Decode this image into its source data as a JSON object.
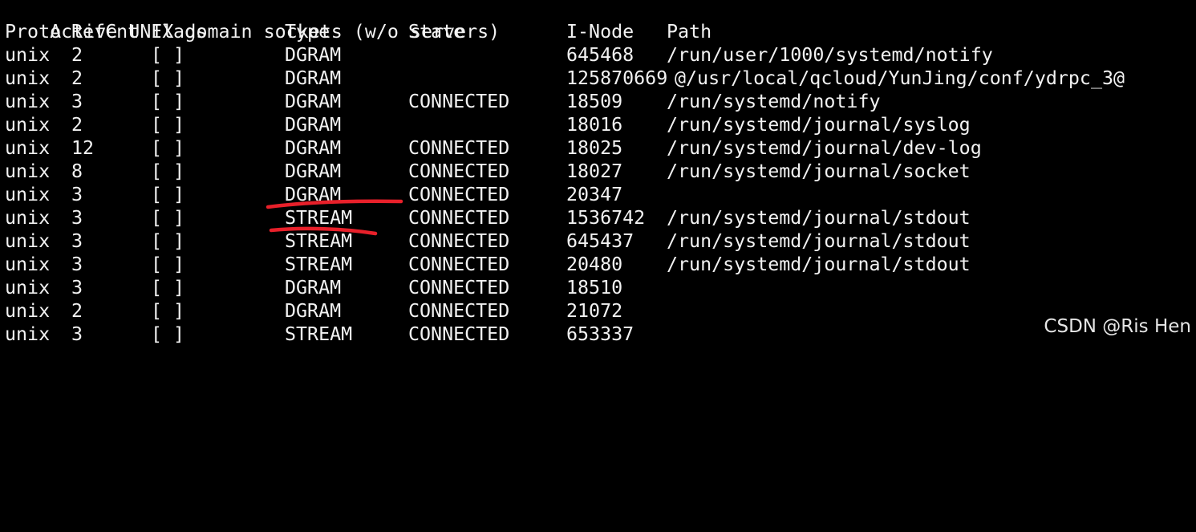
{
  "terminal": {
    "title_line": "Active UNIX domain sockets (w/o servers)",
    "headers": {
      "proto": "Proto",
      "refcnt": "RefCnt",
      "flags": "Flags",
      "type": "Type",
      "state": "State",
      "inode": "I-Node",
      "path": "Path"
    },
    "rows": [
      {
        "proto": "unix",
        "refcnt": "2",
        "flags": "[ ]",
        "type": "DGRAM",
        "state": "",
        "inode": "645468",
        "path": "/run/user/1000/systemd/notify"
      },
      {
        "proto": "unix",
        "refcnt": "2",
        "flags": "[ ]",
        "type": "DGRAM",
        "state": "",
        "inode": "125870669",
        "path": "@/usr/local/qcloud/YunJing/conf/ydrpc_3@"
      },
      {
        "proto": "unix",
        "refcnt": "3",
        "flags": "[ ]",
        "type": "DGRAM",
        "state": "CONNECTED",
        "inode": "18509",
        "path": "/run/systemd/notify"
      },
      {
        "proto": "unix",
        "refcnt": "2",
        "flags": "[ ]",
        "type": "DGRAM",
        "state": "",
        "inode": "18016",
        "path": "/run/systemd/journal/syslog"
      },
      {
        "proto": "unix",
        "refcnt": "12",
        "flags": "[ ]",
        "type": "DGRAM",
        "state": "CONNECTED",
        "inode": "18025",
        "path": "/run/systemd/journal/dev-log"
      },
      {
        "proto": "unix",
        "refcnt": "8",
        "flags": "[ ]",
        "type": "DGRAM",
        "state": "CONNECTED",
        "inode": "18027",
        "path": "/run/systemd/journal/socket"
      },
      {
        "proto": "unix",
        "refcnt": "3",
        "flags": "[ ]",
        "type": "DGRAM",
        "state": "CONNECTED",
        "inode": "20347",
        "path": ""
      },
      {
        "proto": "unix",
        "refcnt": "3",
        "flags": "[ ]",
        "type": "STREAM",
        "state": "CONNECTED",
        "inode": "1536742",
        "path": "/run/systemd/journal/stdout"
      },
      {
        "proto": "unix",
        "refcnt": "3",
        "flags": "[ ]",
        "type": "STREAM",
        "state": "CONNECTED",
        "inode": "645437",
        "path": "/run/systemd/journal/stdout"
      },
      {
        "proto": "unix",
        "refcnt": "3",
        "flags": "[ ]",
        "type": "STREAM",
        "state": "CONNECTED",
        "inode": "20480",
        "path": "/run/systemd/journal/stdout"
      },
      {
        "proto": "unix",
        "refcnt": "3",
        "flags": "[ ]",
        "type": "DGRAM",
        "state": "CONNECTED",
        "inode": "18510",
        "path": ""
      },
      {
        "proto": "unix",
        "refcnt": "2",
        "flags": "[ ]",
        "type": "DGRAM",
        "state": "CONNECTED",
        "inode": "21072",
        "path": ""
      },
      {
        "proto": "unix",
        "refcnt": "3",
        "flags": "[ ]",
        "type": "STREAM",
        "state": "CONNECTED",
        "inode": "653337",
        "path": ""
      }
    ]
  },
  "annotation": {
    "color": "#e8202a"
  },
  "watermark": {
    "text": "CSDN @Ris Hen"
  },
  "colors": {
    "background": "#000000",
    "text": "#f2f2f2"
  }
}
